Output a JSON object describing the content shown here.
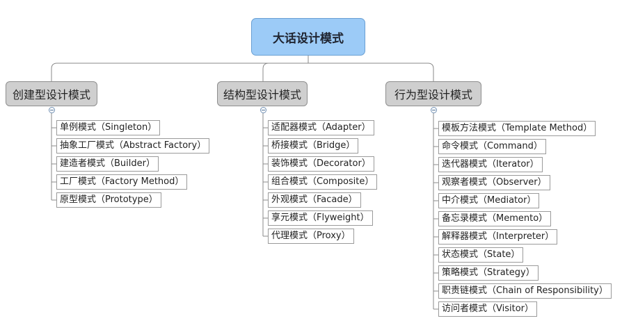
{
  "diagram": {
    "root": {
      "label": "大话设计模式"
    },
    "categories": [
      {
        "label": "创建型设计模式",
        "items": [
          "单例模式（Singleton）",
          "抽象工厂模式（Abstract Factory）",
          "建造者模式（Builder）",
          "工厂模式（Factory Method）",
          "原型模式（Prototype）"
        ]
      },
      {
        "label": "结构型设计模式",
        "items": [
          "适配器模式（Adapter）",
          "桥接模式（Bridge）",
          "装饰模式（Decorator）",
          "组合模式（Composite）",
          "外观模式（Facade）",
          "享元模式（Flyweight）",
          "代理模式（Proxy）"
        ]
      },
      {
        "label": "行为型设计模式",
        "items": [
          "模板方法模式（Template Method）",
          "命令模式（Command）",
          "迭代器模式（Iterator）",
          "观察者模式（Observer）",
          "中介模式（Mediator）",
          "备忘录模式（Memento）",
          "解释器模式（Interpreter）",
          "状态模式（State）",
          "策略模式（Strategy）",
          "职责链模式（Chain of Responsibility）",
          "访问者模式（Visitor）"
        ]
      }
    ]
  }
}
